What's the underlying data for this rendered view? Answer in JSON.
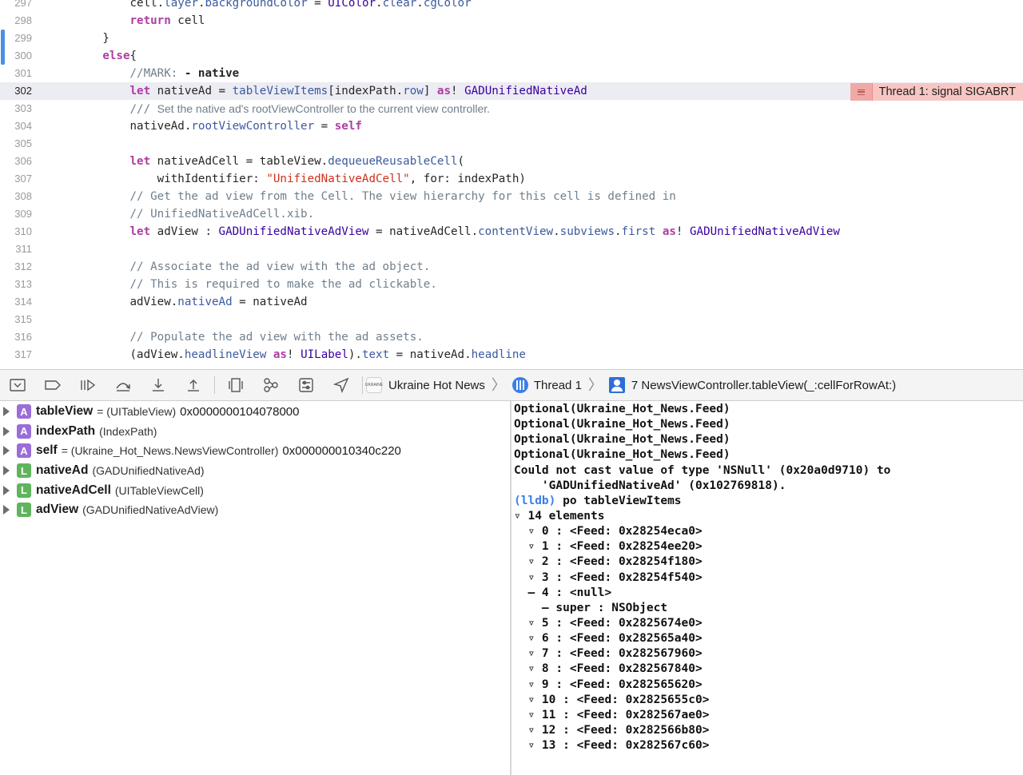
{
  "editor": {
    "lines": [
      {
        "num": "297",
        "indent": "            ",
        "tokens": [
          {
            "t": "cell.",
            "c": ""
          },
          {
            "t": "layer",
            "c": "f"
          },
          {
            "t": ".",
            "c": ""
          },
          {
            "t": "backgroundColor",
            "c": "f"
          },
          {
            "t": " = ",
            "c": ""
          },
          {
            "t": "UIColor",
            "c": "t"
          },
          {
            "t": ".",
            "c": ""
          },
          {
            "t": "clear",
            "c": "f"
          },
          {
            "t": ".",
            "c": ""
          },
          {
            "t": "cgColor",
            "c": "f"
          }
        ]
      },
      {
        "num": "298",
        "indent": "            ",
        "tokens": [
          {
            "t": "return",
            "c": "k"
          },
          {
            "t": " cell",
            "c": ""
          }
        ]
      },
      {
        "num": "299",
        "indent": "        ",
        "tokens": [
          {
            "t": "}",
            "c": ""
          }
        ]
      },
      {
        "num": "300",
        "indent": "        ",
        "tokens": [
          {
            "t": "else",
            "c": "k"
          },
          {
            "t": "{",
            "c": ""
          }
        ]
      },
      {
        "num": "301",
        "indent": "            ",
        "tokens": [
          {
            "t": "//MARK: ",
            "c": "c"
          },
          {
            "t": "- native",
            "c": "m"
          }
        ]
      },
      {
        "num": "302",
        "indent": "            ",
        "highlight": true,
        "tokens": [
          {
            "t": "let",
            "c": "k"
          },
          {
            "t": " nativeAd = ",
            "c": ""
          },
          {
            "t": "tableViewItems",
            "c": "f"
          },
          {
            "t": "[indexPath.",
            "c": ""
          },
          {
            "t": "row",
            "c": "f"
          },
          {
            "t": "] ",
            "c": ""
          },
          {
            "t": "as",
            "c": "k"
          },
          {
            "t": "! ",
            "c": ""
          },
          {
            "t": "GADUnifiedNativeAd",
            "c": "t"
          }
        ]
      },
      {
        "num": "303",
        "indent": "            ",
        "tokens": [
          {
            "t": "/// ",
            "c": "c"
          },
          {
            "t": "Set the native ad's rootViewController to the current view controller.",
            "c": "d"
          }
        ]
      },
      {
        "num": "304",
        "indent": "            ",
        "tokens": [
          {
            "t": "nativeAd.",
            "c": ""
          },
          {
            "t": "rootViewController",
            "c": "f"
          },
          {
            "t": " = ",
            "c": ""
          },
          {
            "t": "self",
            "c": "k"
          }
        ]
      },
      {
        "num": "305",
        "indent": "",
        "tokens": []
      },
      {
        "num": "306",
        "indent": "            ",
        "tokens": [
          {
            "t": "let",
            "c": "k"
          },
          {
            "t": " nativeAdCell = tableView.",
            "c": ""
          },
          {
            "t": "dequeueReusableCell",
            "c": "f"
          },
          {
            "t": "(",
            "c": ""
          }
        ]
      },
      {
        "num": "307",
        "indent": "                ",
        "tokens": [
          {
            "t": "withIdentifier: ",
            "c": ""
          },
          {
            "t": "\"UnifiedNativeAdCell\"",
            "c": "s"
          },
          {
            "t": ", for: indexPath)",
            "c": ""
          }
        ]
      },
      {
        "num": "308",
        "indent": "            ",
        "tokens": [
          {
            "t": "// Get the ad view from the Cell. The view hierarchy for this cell is defined in",
            "c": "c"
          }
        ]
      },
      {
        "num": "309",
        "indent": "            ",
        "tokens": [
          {
            "t": "// UnifiedNativeAdCell.xib.",
            "c": "c"
          }
        ]
      },
      {
        "num": "310",
        "indent": "            ",
        "tokens": [
          {
            "t": "let",
            "c": "k"
          },
          {
            "t": " adView : ",
            "c": ""
          },
          {
            "t": "GADUnifiedNativeAdView",
            "c": "t"
          },
          {
            "t": " = nativeAdCell.",
            "c": ""
          },
          {
            "t": "contentView",
            "c": "f"
          },
          {
            "t": ".",
            "c": ""
          },
          {
            "t": "subviews",
            "c": "f"
          },
          {
            "t": ".",
            "c": ""
          },
          {
            "t": "first",
            "c": "f"
          },
          {
            "t": " ",
            "c": ""
          },
          {
            "t": "as",
            "c": "k"
          },
          {
            "t": "! ",
            "c": ""
          },
          {
            "t": "GADUnifiedNativeAdView",
            "c": "t"
          }
        ]
      },
      {
        "num": "311",
        "indent": "",
        "tokens": []
      },
      {
        "num": "312",
        "indent": "            ",
        "tokens": [
          {
            "t": "// Associate the ad view with the ad object.",
            "c": "c"
          }
        ]
      },
      {
        "num": "313",
        "indent": "            ",
        "tokens": [
          {
            "t": "// This is required to make the ad clickable.",
            "c": "c"
          }
        ]
      },
      {
        "num": "314",
        "indent": "            ",
        "tokens": [
          {
            "t": "adView.",
            "c": ""
          },
          {
            "t": "nativeAd",
            "c": "f"
          },
          {
            "t": " = nativeAd",
            "c": ""
          }
        ]
      },
      {
        "num": "315",
        "indent": "",
        "tokens": []
      },
      {
        "num": "316",
        "indent": "            ",
        "tokens": [
          {
            "t": "// Populate the ad view with the ad assets.",
            "c": "c"
          }
        ]
      },
      {
        "num": "317",
        "indent": "            ",
        "tokens": [
          {
            "t": "(adView.",
            "c": ""
          },
          {
            "t": "headlineView",
            "c": "f"
          },
          {
            "t": " ",
            "c": ""
          },
          {
            "t": "as",
            "c": "k"
          },
          {
            "t": "! ",
            "c": ""
          },
          {
            "t": "UILabel",
            "c": "t"
          },
          {
            "t": ").",
            "c": ""
          },
          {
            "t": "text",
            "c": "f"
          },
          {
            "t": " = nativeAd.",
            "c": ""
          },
          {
            "t": "headline",
            "c": "f"
          }
        ]
      }
    ],
    "error_annotation": {
      "message": "Thread 1: signal SIGABRT",
      "icon": "issue-list-icon",
      "color": "#f7c6c3"
    }
  },
  "debug_bar": {
    "buttons": [
      {
        "name": "hide-debug-area-button",
        "icon": "hide-debug-area-icon"
      },
      {
        "name": "breakpoints-toggle-button",
        "icon": "breakpoint-icon"
      },
      {
        "name": "continue-button",
        "icon": "continue-icon"
      },
      {
        "name": "step-over-button",
        "icon": "step-over-icon"
      },
      {
        "name": "step-into-button",
        "icon": "step-into-icon"
      },
      {
        "name": "step-out-button",
        "icon": "step-out-icon"
      },
      {
        "name": "debug-view-hierarchy-button",
        "icon": "view-hierarchy-icon"
      },
      {
        "name": "debug-memory-graph-button",
        "icon": "memory-graph-icon"
      },
      {
        "name": "environment-overrides-button",
        "icon": "environment-overrides-icon"
      },
      {
        "name": "simulate-location-button",
        "icon": "location-icon"
      }
    ],
    "breadcrumbs": {
      "app": "Ukraine Hot News",
      "app_icon_text": "UKRAINE",
      "thread": "Thread 1",
      "frame": "7 NewsViewController.tableView(_:cellForRowAt:)"
    }
  },
  "variables": [
    {
      "badge": "A",
      "kind": "arg",
      "name": "tableView",
      "type": "= (UITableView)",
      "value": "0x0000000104078000"
    },
    {
      "badge": "A",
      "kind": "arg",
      "name": "indexPath",
      "type": "(IndexPath)",
      "value": ""
    },
    {
      "badge": "A",
      "kind": "arg",
      "name": "self",
      "type": "= (Ukraine_Hot_News.NewsViewController)",
      "value": "0x000000010340c220"
    },
    {
      "badge": "L",
      "kind": "loc",
      "name": "nativeAd",
      "type": "(GADUnifiedNativeAd)",
      "value": ""
    },
    {
      "badge": "L",
      "kind": "loc",
      "name": "nativeAdCell",
      "type": "(UITableViewCell)",
      "value": ""
    },
    {
      "badge": "L",
      "kind": "loc",
      "name": "adView",
      "type": "(GADUnifiedNativeAdView)",
      "value": ""
    }
  ],
  "console": {
    "lines": [
      {
        "text": "Optional(Ukraine_Hot_News.Feed)"
      },
      {
        "text": "Optional(Ukraine_Hot_News.Feed)"
      },
      {
        "text": "Optional(Ukraine_Hot_News.Feed)"
      },
      {
        "text": "Optional(Ukraine_Hot_News.Feed)"
      },
      {
        "text": "Could not cast value of type 'NSNull' (0x20a0d9710) to"
      },
      {
        "text": "    'GADUnifiedNativeAd' (0x102769818)."
      },
      {
        "prompt": "(lldb)",
        "text": " po tableViewItems"
      },
      {
        "text": "▿ 14 elements"
      },
      {
        "text": "  ▿ 0 : <Feed: 0x28254eca0>"
      },
      {
        "text": "  ▿ 1 : <Feed: 0x28254ee20>"
      },
      {
        "text": "  ▿ 2 : <Feed: 0x28254f180>"
      },
      {
        "text": "  ▿ 3 : <Feed: 0x28254f540>"
      },
      {
        "text": "  – 4 : <null>"
      },
      {
        "text": "    – super : NSObject"
      },
      {
        "text": "  ▿ 5 : <Feed: 0x2825674e0>"
      },
      {
        "text": "  ▿ 6 : <Feed: 0x282565a40>"
      },
      {
        "text": "  ▿ 7 : <Feed: 0x282567960>"
      },
      {
        "text": "  ▿ 8 : <Feed: 0x282567840>"
      },
      {
        "text": "  ▿ 9 : <Feed: 0x282565620>"
      },
      {
        "text": "  ▿ 10 : <Feed: 0x2825655c0>"
      },
      {
        "text": "  ▿ 11 : <Feed: 0x282567ae0>"
      },
      {
        "text": "  ▿ 12 : <Feed: 0x282566b80>"
      },
      {
        "text": "  ▿ 13 : <Feed: 0x282567c60>"
      }
    ]
  }
}
